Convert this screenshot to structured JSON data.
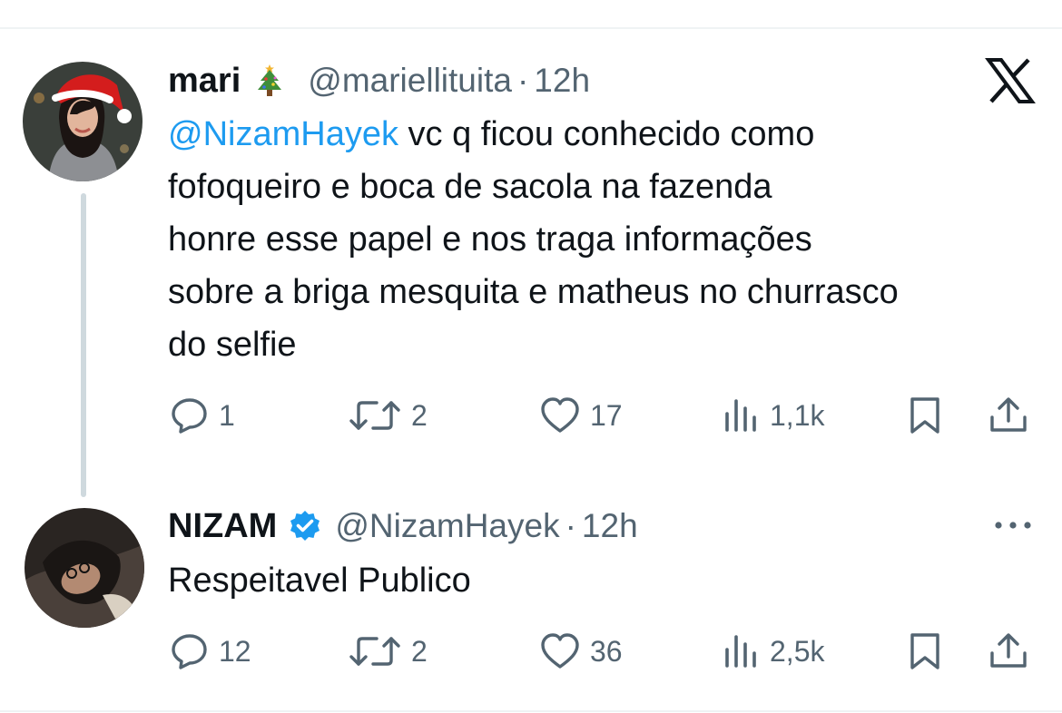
{
  "tweets": [
    {
      "display_name": "mari",
      "name_emoji_icon": "christmas-tree",
      "handle": "@mariellituita",
      "separator": "·",
      "time": "12h",
      "mention": "@NizamHayek",
      "text_lines": [
        " vc q ficou conhecido como",
        "fofoqueiro e boca de sacola na fazenda",
        "honre esse papel e nos traga informações",
        "sobre a briga mesquita e matheus no churrasco",
        "do selfie"
      ],
      "stats": {
        "replies": "1",
        "reposts": "2",
        "likes": "17",
        "views": "1,1k"
      }
    },
    {
      "display_name": "NIZAM",
      "verified_icon": "verified-badge",
      "handle": "@NizamHayek",
      "separator": "·",
      "time": "12h",
      "text": "Respeitavel Publico",
      "stats": {
        "replies": "12",
        "reposts": "2",
        "likes": "36",
        "views": "2,5k"
      }
    }
  ],
  "icons": [
    "x-logo",
    "more-icon",
    "reply-icon",
    "repost-icon",
    "like-icon",
    "views-icon",
    "bookmark-icon",
    "share-icon"
  ],
  "colors": {
    "link": "#1d9bf0",
    "secondary_text": "#536471",
    "thread_line": "#cfd9de",
    "verified": "#1d9bf0"
  }
}
